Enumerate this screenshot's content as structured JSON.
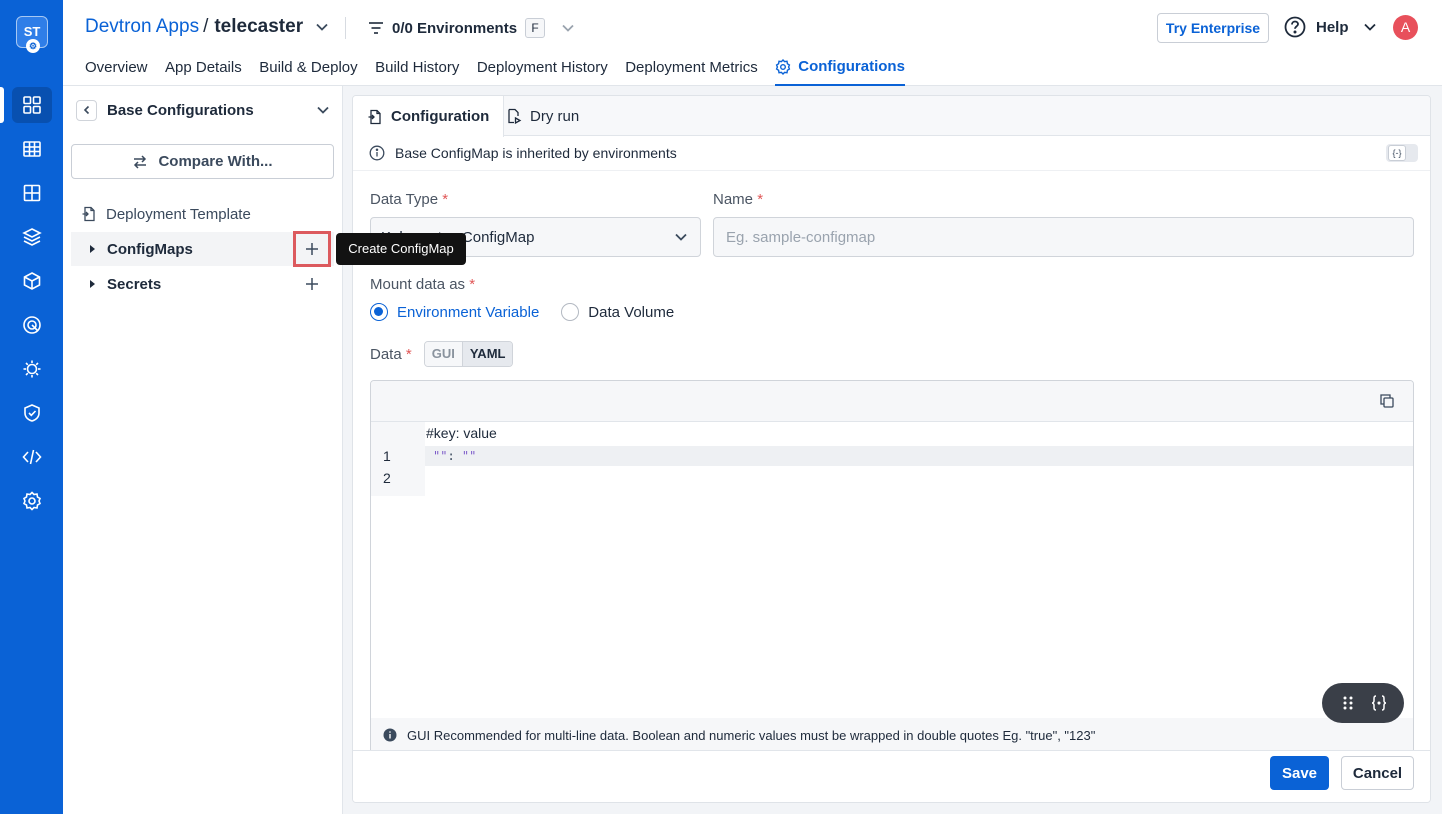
{
  "rail": {
    "logo_text": "ST",
    "items": [
      "apps-grid-icon",
      "charts-icon",
      "app-groups-icon",
      "stack-icon",
      "cube-icon",
      "security-scan-icon",
      "bug-icon",
      "shield-check-icon",
      "code-icon",
      "settings-icon"
    ]
  },
  "header": {
    "app_link": "Devtron Apps",
    "separator": "/",
    "app_name": "telecaster",
    "env_selector": "0/0 Environments",
    "env_shortcut": "F",
    "try_enterprise": "Try Enterprise",
    "help": "Help",
    "avatar_initial": "A",
    "tabs": [
      "Overview",
      "App Details",
      "Build & Deploy",
      "Build History",
      "Deployment History",
      "Deployment Metrics",
      "Configurations"
    ],
    "active_tab": "Configurations"
  },
  "sidebar": {
    "title": "Base Configurations",
    "compare_button": "Compare With...",
    "items": [
      {
        "label": "Deployment Template"
      },
      {
        "label": "ConfigMaps"
      },
      {
        "label": "Secrets"
      }
    ]
  },
  "tooltip": "Create ConfigMap",
  "main": {
    "tabs": [
      "Configuration",
      "Dry run"
    ],
    "info_text": "Base ConfigMap is inherited by environments",
    "toggle_glyph": "{-}",
    "data_type_label": "Data Type",
    "data_type_value": "Kubernetes ConfigMap",
    "name_label": "Name",
    "name_placeholder": "Eg. sample-configmap",
    "required_mark": "*",
    "mount_label": "Mount data as",
    "mount_options": [
      "Environment Variable",
      "Data Volume"
    ],
    "mount_selected": "Environment Variable",
    "data_label": "Data",
    "data_modes": [
      "GUI",
      "YAML"
    ],
    "data_mode_selected": "YAML",
    "editor": {
      "comment": "#key: value",
      "line_numbers": [
        "1",
        "2"
      ],
      "line1": {
        "q1": "\"\"",
        "colon": ":",
        "q2": "\"\""
      }
    },
    "hint": "GUI Recommended for multi-line data. Boolean and numeric values must be wrapped in double quotes Eg. \"true\", \"123\"",
    "save": "Save",
    "cancel": "Cancel"
  }
}
